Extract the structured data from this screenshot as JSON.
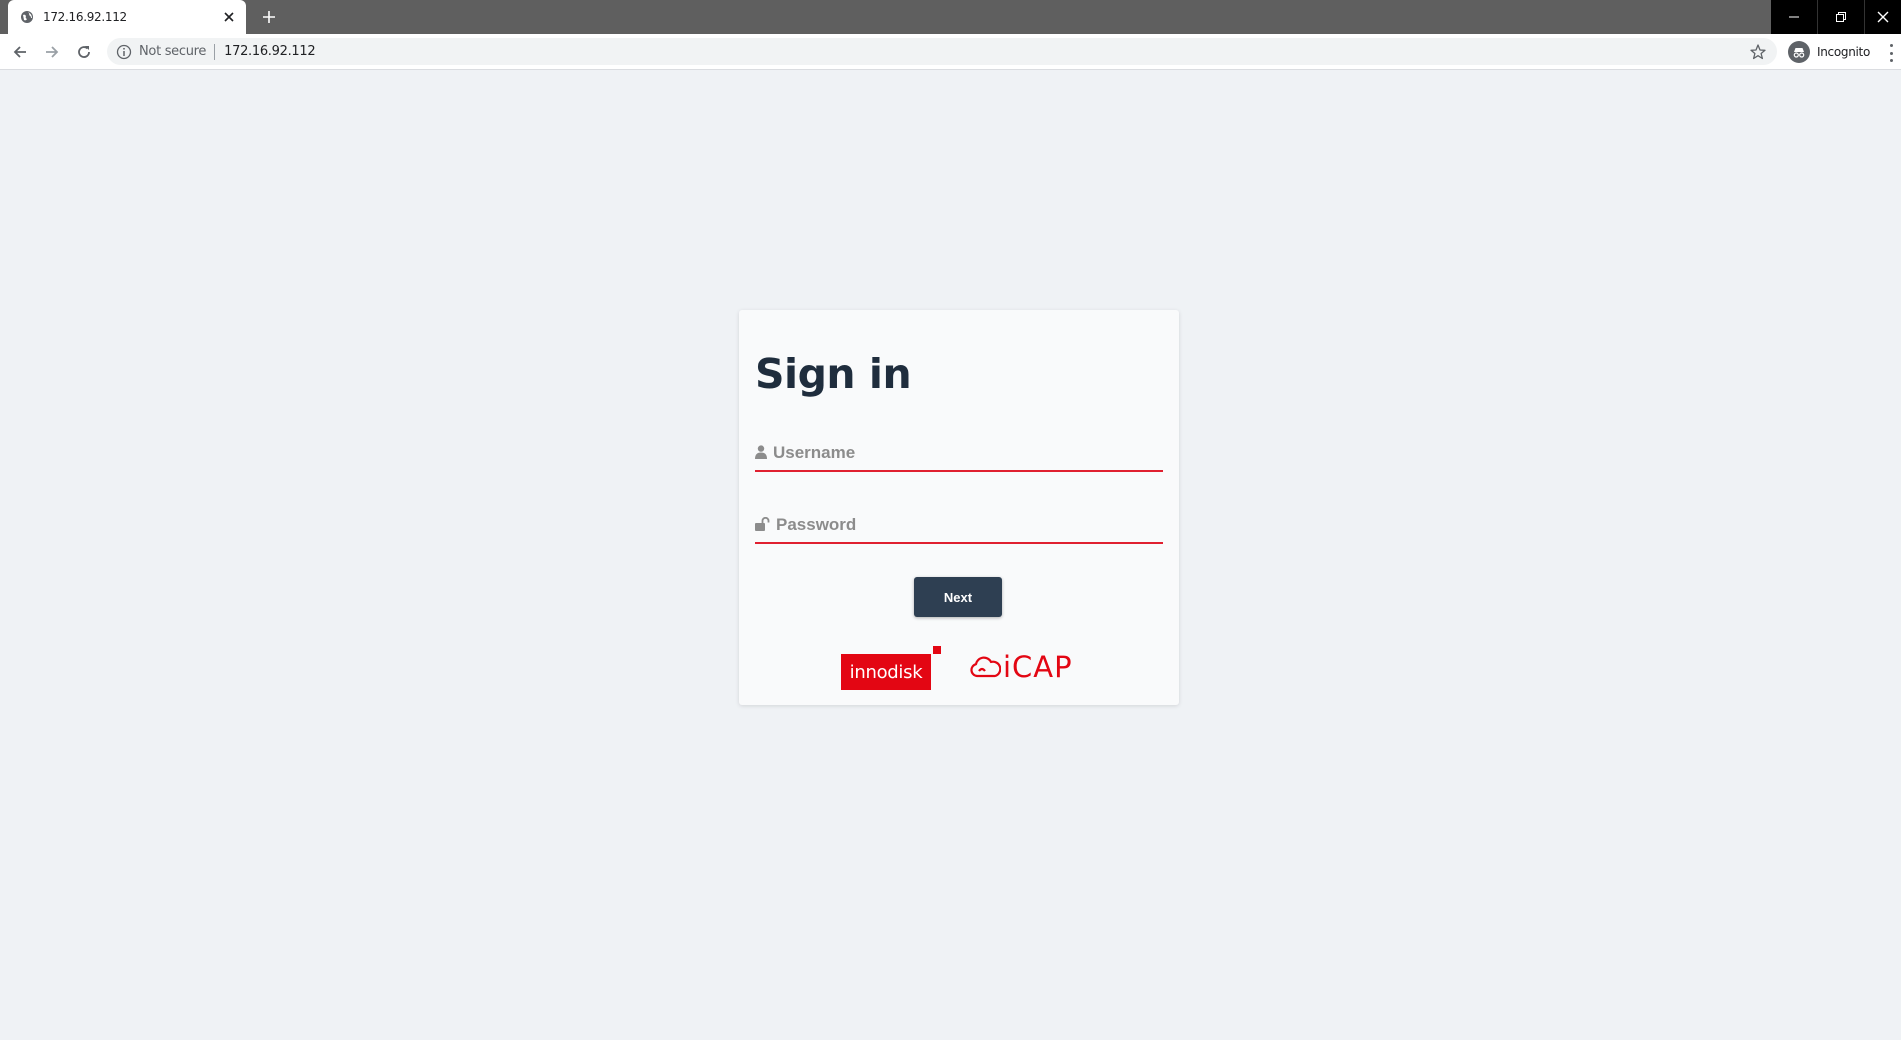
{
  "browser": {
    "tab_title": "172.16.92.112",
    "security_label": "Not secure",
    "url": "172.16.92.112",
    "incognito_label": "Incognito"
  },
  "signin": {
    "title": "Sign in",
    "username_placeholder": "Username",
    "username_value": "",
    "password_placeholder": "Password",
    "password_value": "",
    "next_label": "Next"
  },
  "logos": {
    "innodisk": "innodisk",
    "icap": "iCAP",
    "brand_color": "#e30613"
  },
  "icons": [
    "globe-icon",
    "close-icon",
    "plus-icon",
    "minimize-icon",
    "restore-icon",
    "back-icon",
    "forward-icon",
    "reload-icon",
    "info-icon",
    "star-icon",
    "incognito-icon",
    "menu-icon",
    "user-icon",
    "unlock-icon",
    "cloud-icon"
  ]
}
